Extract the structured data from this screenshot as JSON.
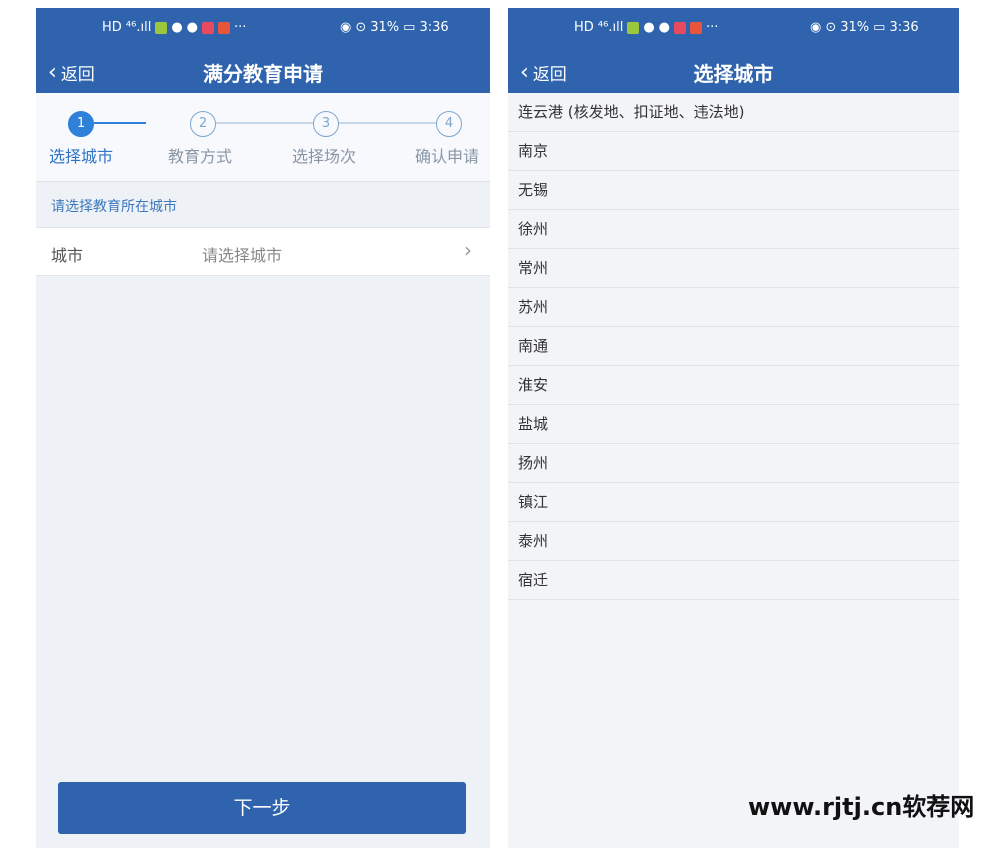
{
  "left": {
    "status": {
      "icons_left": "HD ⁴⁶.ıll",
      "battery": "31%",
      "time": "3:36"
    },
    "nav": {
      "back_label": "返回",
      "title": "满分教育申请"
    },
    "steps": [
      {
        "num": "1",
        "label": "选择城市",
        "active": true
      },
      {
        "num": "2",
        "label": "教育方式",
        "active": false
      },
      {
        "num": "3",
        "label": "选择场次",
        "active": false
      },
      {
        "num": "4",
        "label": "确认申请",
        "active": false
      }
    ],
    "hint": "请选择教育所在城市",
    "city_field": {
      "label": "城市",
      "placeholder": "请选择城市"
    },
    "next_button": "下一步"
  },
  "right": {
    "status": {
      "icons_left": "HD ⁴⁶.ıll",
      "battery": "31%",
      "time": "3:36"
    },
    "nav": {
      "back_label": "返回",
      "title": "选择城市"
    },
    "cities": [
      "连云港 (核发地、扣证地、违法地)",
      "南京",
      "无锡",
      "徐州",
      "常州",
      "苏州",
      "南通",
      "淮安",
      "盐城",
      "扬州",
      "镇江",
      "泰州",
      "宿迁"
    ]
  },
  "watermark": "www.rjtj.cn软荐网",
  "colors": {
    "primary": "#2f63ad",
    "step_active": "#2f80d9",
    "hint": "#3e78bd"
  }
}
